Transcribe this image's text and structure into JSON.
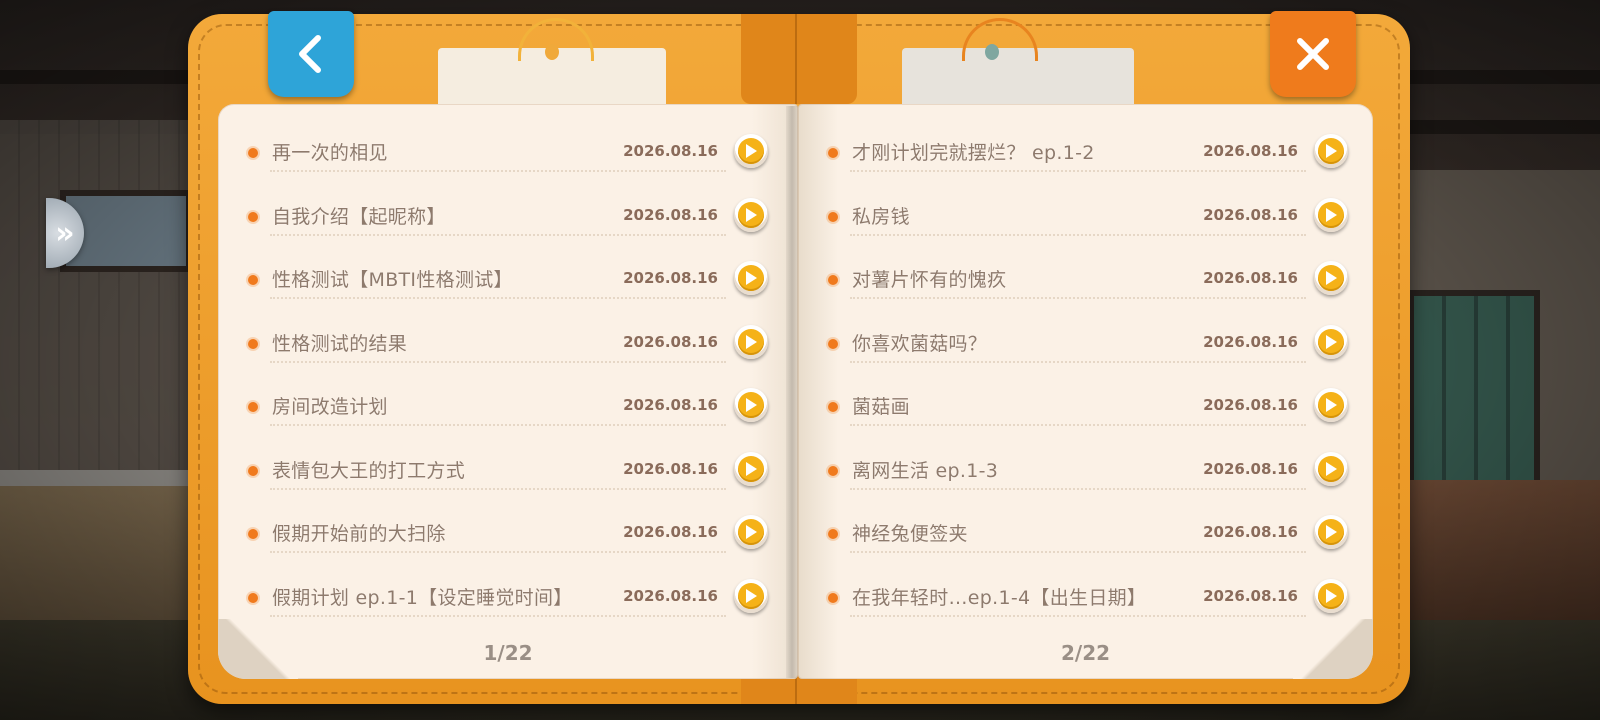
{
  "left_page": {
    "page_label": "1/22",
    "entries": [
      {
        "title": "再一次的相见",
        "date": "2026.08.16"
      },
      {
        "title": "自我介绍【起昵称】",
        "date": "2026.08.16"
      },
      {
        "title": "性格测试【MBTI性格测试】",
        "date": "2026.08.16"
      },
      {
        "title": "性格测试的结果",
        "date": "2026.08.16"
      },
      {
        "title": "房间改造计划",
        "date": "2026.08.16"
      },
      {
        "title": "表情包大王的打工方式",
        "date": "2026.08.16"
      },
      {
        "title": "假期开始前的大扫除",
        "date": "2026.08.16"
      },
      {
        "title": "假期计划 ep.1-1【设定睡觉时间】",
        "date": "2026.08.16"
      }
    ]
  },
  "right_page": {
    "page_label": "2/22",
    "entries": [
      {
        "title": "才刚计划完就摆烂？ ep.1-2",
        "date": "2026.08.16"
      },
      {
        "title": "私房钱",
        "date": "2026.08.16"
      },
      {
        "title": "对薯片怀有的愧疚",
        "date": "2026.08.16"
      },
      {
        "title": "你喜欢菌菇吗？",
        "date": "2026.08.16"
      },
      {
        "title": "菌菇画",
        "date": "2026.08.16"
      },
      {
        "title": "离网生活 ep.1-3",
        "date": "2026.08.16"
      },
      {
        "title": "神经兔便签夹",
        "date": "2026.08.16"
      },
      {
        "title": "在我年轻时…ep.1-4【出生日期】",
        "date": "2026.08.16"
      }
    ]
  },
  "icons": {
    "back": "chevron-left-icon",
    "close": "close-icon",
    "play": "play-icon",
    "side": "double-chevron-right-icon"
  },
  "colors": {
    "book_cover": "#f3a93a",
    "back_button": "#2ea4d8",
    "close_button": "#ef7b1c",
    "bullet": "#f07a1d",
    "play_button": "#f5b218"
  }
}
